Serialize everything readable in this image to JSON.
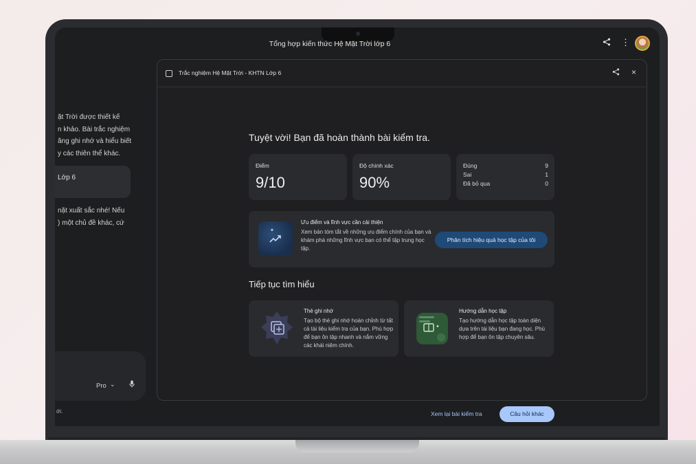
{
  "window": {
    "title": "Tổng hợp kiến thức Hệ Mặt Trời lớp 6"
  },
  "chat": {
    "lines_block1": [
      "ặt Trời được thiết kế",
      "n khảo. Bài trắc nghiệm",
      "ăng ghi nhớ và hiểu biết",
      "y các thiên thể khác."
    ],
    "card_label": "Lớp 6",
    "lines_block2": [
      "nặt xuất sắc nhé! Nếu",
      ") một chủ đề khác, cứ"
    ],
    "model_label": "Pro",
    "footnote": "ới."
  },
  "panel": {
    "title": "Trắc nghiệm Hệ Mặt Trời - KHTN Lớp 6",
    "headline": "Tuyệt vời! Bạn đã hoàn thành bài kiểm tra.",
    "score": {
      "label": "Điểm",
      "value": "9/10"
    },
    "accuracy": {
      "label": "Độ chính xác",
      "value": "90%"
    },
    "tally": [
      {
        "label": "Đúng",
        "value": "9"
      },
      {
        "label": "Sai",
        "value": "1"
      },
      {
        "label": "Đã bỏ qua",
        "value": "0"
      }
    ],
    "insight": {
      "title": "Ưu điểm và lĩnh vực cần cải thiện",
      "desc": "Xem bản tóm tắt về những ưu điểm chính của bạn và khám phá những lĩnh vực bạn có thể tập trung học tập.",
      "button": "Phân tích hiệu quả học tập của tôi"
    },
    "section_title": "Tiếp tục tìm hiểu",
    "cards": [
      {
        "title": "Thẻ ghi nhớ",
        "desc": "Tạo bộ thẻ ghi nhớ hoàn chỉnh từ tất cả tài liệu kiểm tra của bạn. Phù hợp để bạn ôn tập nhanh và nắm vững các khái niệm chính."
      },
      {
        "title": "Hướng dẫn học tập",
        "desc": "Tạo hướng dẫn học tập toàn diện dựa trên tài liệu bạn đang học. Phù hợp để bạn ôn tập chuyên sâu."
      }
    ],
    "review_button": "Xem lại bài kiểm tra",
    "other_button": "Câu hỏi khác"
  },
  "colors": {
    "accent": "#a8c7fa",
    "insight_button": "#1f4a77",
    "screen_bg": "#1d1e20",
    "card_bg": "#2a2b2e"
  },
  "icons": {
    "top_share": "share-icon",
    "top_more": "more-vert-icon",
    "panel_doc": "quiz-doc-icon",
    "panel_share": "share-icon",
    "panel_close": "close-icon",
    "insight": "trending-up-icon",
    "flashcards": "flashcards-icon",
    "study_guide": "study-guide-icon",
    "chevron": "chevron-down-icon",
    "mic": "mic-icon"
  }
}
